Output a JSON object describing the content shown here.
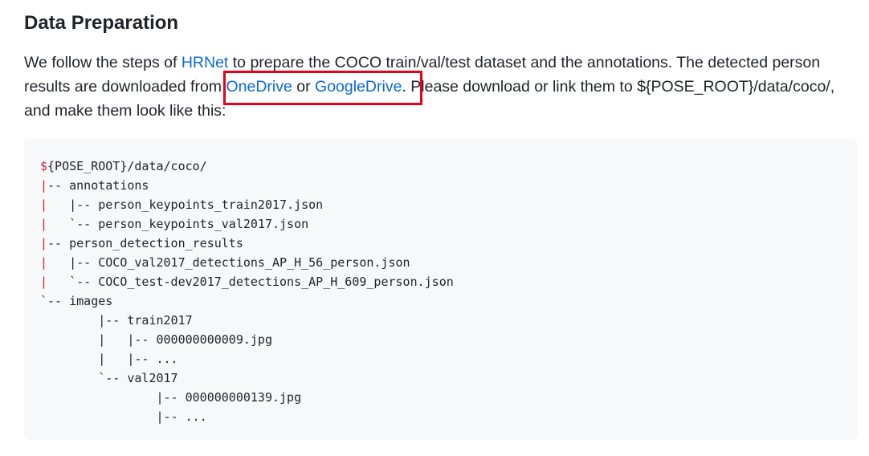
{
  "section": {
    "title": "Data Preparation"
  },
  "paragraph": {
    "text_1": "We follow the steps of ",
    "hrnet_link": "HRNet",
    "text_2": " to prepare the COCO train/val/test dataset and the annotations. The detected person results are downloaded from ",
    "onedrive_link": "OneDrive",
    "text_3": " or ",
    "googledrive_link": "GoogleDrive",
    "text_4": ". Please download or link them to ${POSE_ROOT}/data/coco/, and make them look like this:"
  },
  "highlight": {
    "color": "#e8001c"
  },
  "code": {
    "lines": [
      {
        "pre": "$",
        "rest": "{POSE_ROOT}/data/coco/"
      },
      {
        "pre": "|",
        "rest": "-- annotations"
      },
      {
        "pre": "|",
        "rest": "   |-- person_keypoints_train2017.json"
      },
      {
        "pre": "|",
        "rest": "   `-- person_keypoints_val2017.json"
      },
      {
        "pre": "|",
        "rest": "-- person_detection_results"
      },
      {
        "pre": "|",
        "rest": "   |-- COCO_val2017_detections_AP_H_56_person.json"
      },
      {
        "pre": "|",
        "rest": "   `-- COCO_test-dev2017_detections_AP_H_609_person.json"
      },
      {
        "pre": "",
        "rest": "`-- images"
      },
      {
        "pre": "",
        "rest": "        |-- train2017"
      },
      {
        "pre": "",
        "rest": "        |   |-- 000000000009.jpg"
      },
      {
        "pre": "",
        "rest": "        |   |-- ..."
      },
      {
        "pre": "",
        "rest": "        `-- val2017"
      },
      {
        "pre": "",
        "rest": "                |-- 000000000139.jpg"
      },
      {
        "pre": "",
        "rest": "                |-- ..."
      }
    ]
  }
}
